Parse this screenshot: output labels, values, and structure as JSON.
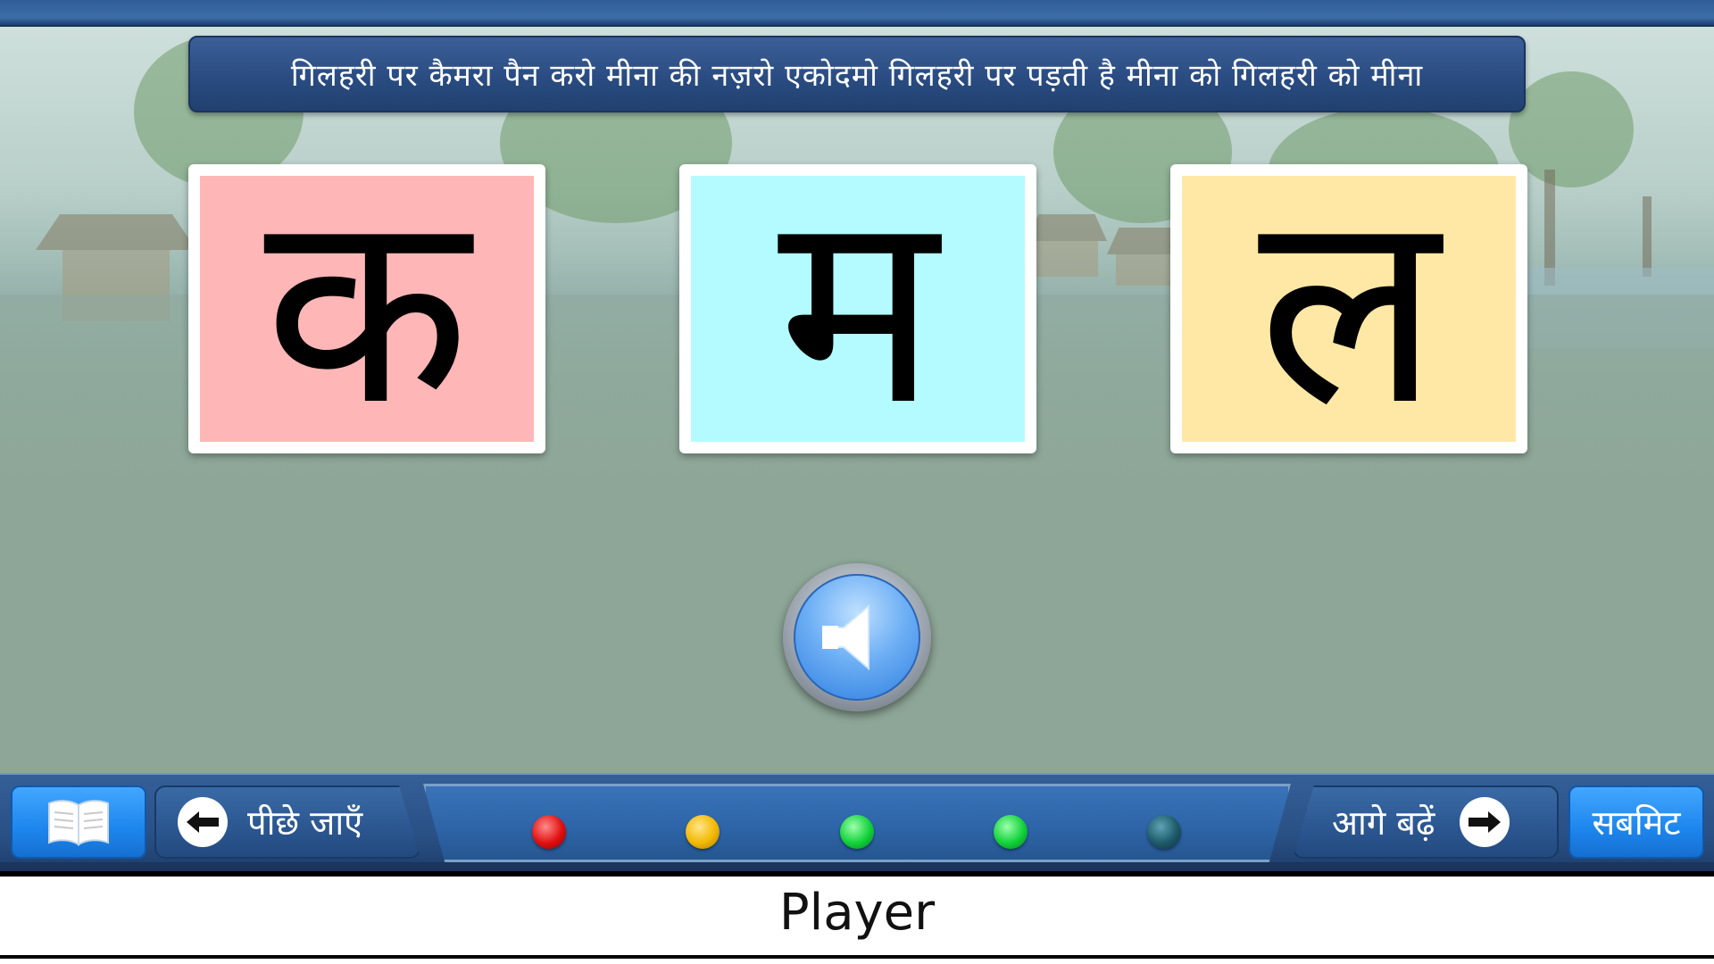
{
  "subtitle": {
    "text": "गिलहरी पर कैमरा पैन करो मीना की नज़रो एकोदमो गिलहरी पर पड़ती है मीना को गिलहरी को मीना"
  },
  "cards": [
    {
      "letter": "क",
      "color": "#ffb6b6"
    },
    {
      "letter": "म",
      "color": "#b3fbff"
    },
    {
      "letter": "ल",
      "color": "#ffe8a6"
    }
  ],
  "speaker": {
    "icon": "speaker-icon"
  },
  "toolbar": {
    "book_icon": "book-icon",
    "back_label": "पीछे जाएँ",
    "next_label": "आगे बढ़ें",
    "submit_label": "सबमिट"
  },
  "progress": {
    "dots": [
      {
        "status": "red",
        "color": "#e01010"
      },
      {
        "status": "yellow",
        "color": "#f2b800"
      },
      {
        "status": "green",
        "color": "#12d23a"
      },
      {
        "status": "green",
        "color": "#12d23a"
      },
      {
        "status": "pending",
        "color": "#1d5a6a"
      }
    ]
  },
  "player": {
    "label": "Player"
  }
}
